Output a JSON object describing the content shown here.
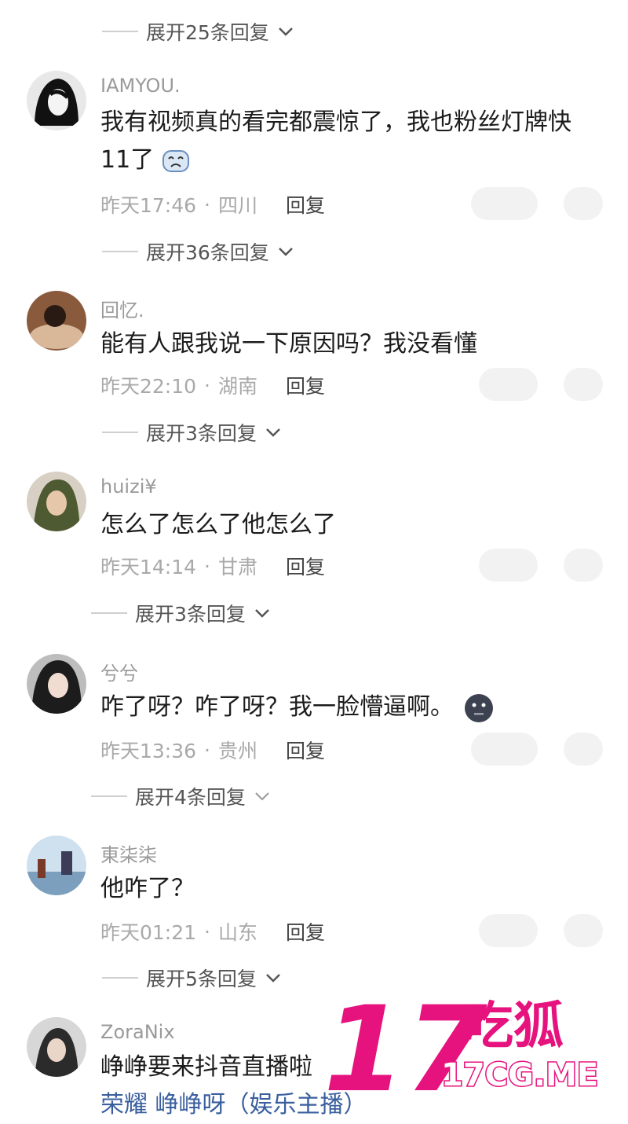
{
  "expanders": [
    {
      "label": "展开25条回复"
    },
    {
      "label": "展开36条回复"
    },
    {
      "label": "展开3条回复"
    },
    {
      "label": "展开3条回复"
    },
    {
      "label": "展开4条回复"
    },
    {
      "label": "展开5条回复"
    }
  ],
  "comments": [
    {
      "user": "IAMYOU.",
      "text": "我有视频真的看完都震惊了，我也粉丝灯牌快",
      "text2": "11了",
      "time": "昨天17:46",
      "sep": "·",
      "location": "四川",
      "reply": "回复"
    },
    {
      "user": "回忆.",
      "text": "能有人跟我说一下原因吗？我没看懂",
      "time": "昨天22:10",
      "sep": "·",
      "location": "湖南",
      "reply": "回复"
    },
    {
      "user": "huizi¥",
      "text": "怎么了怎么了他怎么了",
      "time": "昨天14:14",
      "sep": "·",
      "location": "甘肃",
      "reply": "回复"
    },
    {
      "user": "兮兮",
      "text": "咋了呀？咋了呀？我一脸懵逼啊。",
      "time": "昨天13:36",
      "sep": "·",
      "location": "贵州",
      "reply": "回复"
    },
    {
      "user": "東柒柒",
      "text": "他咋了？",
      "time": "昨天01:21",
      "sep": "·",
      "location": "山东",
      "reply": "回复"
    },
    {
      "user": "ZoraNix",
      "text": "峥峥要来抖音直播啦",
      "text2": "荣耀 峥峥呀（娱乐主播）"
    }
  ],
  "watermark": {
    "big": "17",
    "cn": "吃狐",
    "domain": "17CG.ME"
  },
  "colors": {
    "watermark": "#e6127d",
    "link": "#3a5f9e"
  }
}
